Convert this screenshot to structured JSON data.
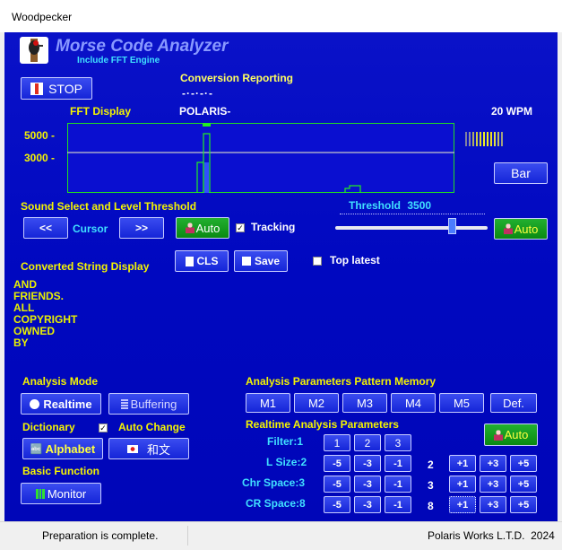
{
  "window": {
    "title": "Woodpecker"
  },
  "app": {
    "name": "Morse Code Analyzer",
    "subtitle": "Include FFT Engine"
  },
  "header": {
    "stop_label": "STOP",
    "conversion_reporting_label": "Conversion Reporting",
    "morse_pattern": "-·-·-·-",
    "callsign": "POLARIS-",
    "wpm": "20 WPM",
    "fft_display_label": "FFT Display"
  },
  "fft": {
    "y_labels": [
      "5000 -",
      "3000 -"
    ],
    "bar_button": "Bar"
  },
  "sound": {
    "title": "Sound Select and Level Threshold",
    "prev": "<<",
    "cursor": "Cursor",
    "next": ">>",
    "auto": "Auto",
    "tracking": "Tracking",
    "threshold_label": "Threshold",
    "threshold_value": "3500",
    "threshold_level": 0.77,
    "auto_right": "Auto"
  },
  "converted": {
    "title": "Converted String Display",
    "cls": "CLS",
    "save": "Save",
    "top_latest": "Top latest",
    "lines": [
      "AND",
      "FRIENDS.",
      "ALL",
      "COPYRIGHT",
      "OWNED",
      "BY"
    ]
  },
  "analysis": {
    "mode_title": "Analysis Mode",
    "realtime": "Realtime",
    "buffering": "Buffering",
    "dictionary_title": "Dictionary",
    "auto_change": "Auto Change",
    "alphabet": "Alphabet",
    "wabun": "和文",
    "basic_function": "Basic Function",
    "monitor": "Monitor"
  },
  "pattern_memory": {
    "title": "Analysis Parameters Pattern Memory",
    "buttons": [
      "M1",
      "M2",
      "M3",
      "M4",
      "M5",
      "Def."
    ]
  },
  "realtime_params": {
    "title": "Realtime Analysis Parameters",
    "auto": "Auto",
    "filter_label": "Filter:1",
    "filter_buttons": [
      "1",
      "2",
      "3"
    ],
    "lsize_label": "L Size:2",
    "chrspace_label": "Chr Space:3",
    "crspace_label": "CR Space:8",
    "minus_buttons": [
      "-5",
      "-3",
      "-1"
    ],
    "plus_buttons": [
      "+1",
      "+3",
      "+5"
    ],
    "lsize_value": "2",
    "chrspace_value": "3",
    "crspace_value": "8"
  },
  "status": {
    "left": "Preparation is complete.",
    "right": "Polaris Works L.T.D.  2024"
  }
}
